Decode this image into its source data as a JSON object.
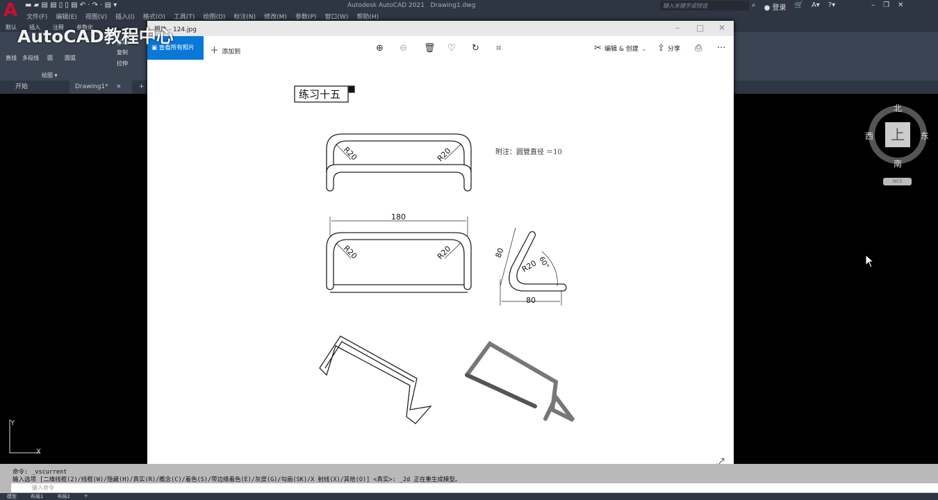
{
  "app": {
    "title": "Autodesk AutoCAD 2021",
    "file": "Drawing1.dwg",
    "logo": "A"
  },
  "menu": [
    "文件(F)",
    "编辑(E)",
    "视图(V)",
    "插入(I)",
    "格式(O)",
    "工具(T)",
    "绘图(D)",
    "标注(N)",
    "修改(M)",
    "参数(P)",
    "窗口(W)",
    "帮助(H)"
  ],
  "search": {
    "placeholder": "键入关键字或短语"
  },
  "login": "登录",
  "ribbon": {
    "tabs": [
      "默认",
      "插入",
      "注释",
      "参数化"
    ],
    "tools": [
      "直线",
      "多段线",
      "圆",
      "圆弧",
      "移动",
      "复制",
      "拉伸"
    ],
    "panel": "绘图 ▾"
  },
  "filetabs": {
    "start": "开始",
    "drawing": "Drawing1*",
    "close": "×",
    "add": "+"
  },
  "watermark": "AutoCAD教程中心",
  "viewer": {
    "title": "照片 - 124.jpg",
    "all_photos": "查看所有照片",
    "add_to": "添加到",
    "edit_create": "编辑 & 创建",
    "share": "分享",
    "more": "···"
  },
  "drawing": {
    "title": "练习十五",
    "note": "附注：圆管直径 ＝10",
    "r": "R20",
    "dim180": "180",
    "dim80a": "80",
    "dim80b": "80",
    "angle": "60°"
  },
  "compass": {
    "n": "北",
    "s": "南",
    "e": "东",
    "w": "西",
    "top": "上",
    "wcs": "WCS"
  },
  "command": {
    "line1": "命令: _vscurrent",
    "line2": "输入选项 [二维线框(2)/线框(W)/隐藏(H)/真实(R)/概念(C)/着色(S)/带边缘着色(E)/灰度(G)/勾画(SK)/X 射线(X)/其他(O)] <真实>: _2d 正在重生成模型。",
    "placeholder": "键入命令"
  },
  "status": {
    "tabs": [
      "模型",
      "布局1",
      "布局2",
      "+"
    ]
  },
  "axis": {
    "x": "X",
    "y": "Y"
  }
}
